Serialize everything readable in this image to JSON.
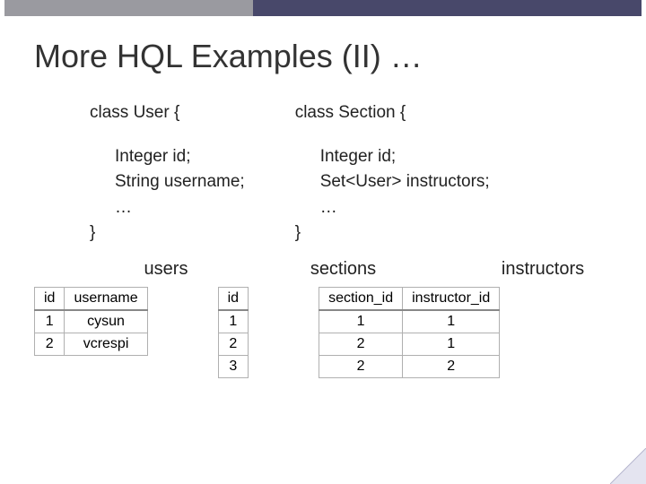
{
  "title": "More HQL Examples (II) …",
  "class_left": {
    "decl": "class User {",
    "line1": "Integer id;",
    "line2": "String username;",
    "line3": "…",
    "close": "}"
  },
  "class_right": {
    "decl": "class Section {",
    "line1": "Integer id;",
    "line2": "Set<User> instructors;",
    "line3": "…",
    "close": "}"
  },
  "tables_titles": {
    "users": "users",
    "sections": "sections",
    "instructors": "instructors"
  },
  "users_table": {
    "headers": [
      "id",
      "username"
    ],
    "rows": [
      [
        "1",
        "cysun"
      ],
      [
        "2",
        "vcrespi"
      ]
    ]
  },
  "sections_table": {
    "headers": [
      "id"
    ],
    "rows": [
      [
        "1"
      ],
      [
        "2"
      ],
      [
        "3"
      ]
    ]
  },
  "instructors_table": {
    "headers": [
      "section_id",
      "instructor_id"
    ],
    "rows": [
      [
        "1",
        "1"
      ],
      [
        "2",
        "1"
      ],
      [
        "2",
        "2"
      ]
    ]
  }
}
